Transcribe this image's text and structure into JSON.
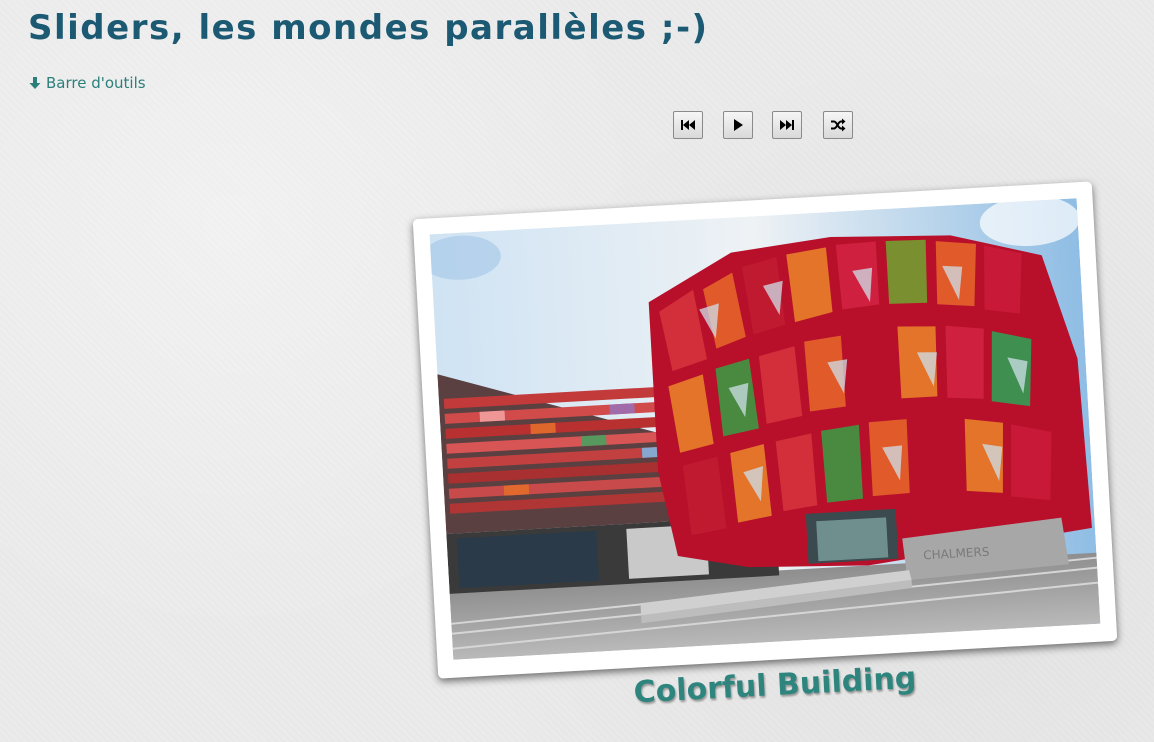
{
  "page": {
    "title": "Sliders, les mondes parallèles ;-)"
  },
  "toolbar_toggle": {
    "label": "Barre d'outils",
    "icon": "arrow-down-icon"
  },
  "controls": {
    "previous_icon": "rewind-icon",
    "play_icon": "play-icon",
    "next_icon": "fast-forward-icon",
    "shuffle_icon": "shuffle-icon"
  },
  "slide": {
    "caption": "Colorful Building",
    "sign_text": "CHALMERS"
  },
  "colors": {
    "title": "#1c5a73",
    "link": "#2b7f7a",
    "caption": "#2e857e",
    "background": "#ebebeb"
  }
}
